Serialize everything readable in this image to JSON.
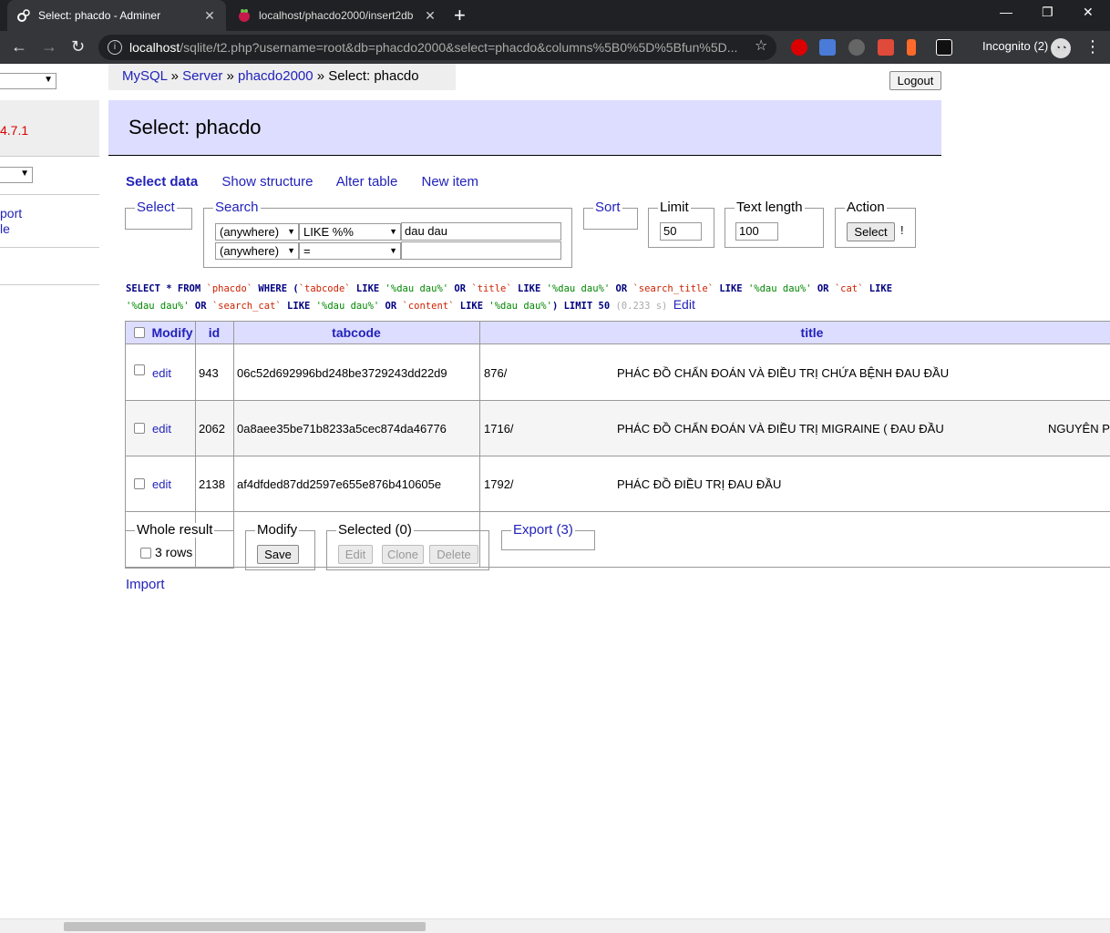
{
  "browser": {
    "tabs": [
      {
        "title": "Select: phacdo - Adminer"
      },
      {
        "title": "localhost/phacdo2000/insert2db"
      }
    ],
    "url_host": "localhost",
    "url_path": "/sqlite/t2.php?username=root&db=phacdo2000&select=phacdo&columns%5B0%5D%5Bfun%5D...",
    "incognito_label": "Incognito (2)"
  },
  "sidebar": {
    "version": "4.7.1",
    "link1": "port",
    "link2": "le"
  },
  "breadcrumb": {
    "mysql": "MySQL",
    "server": "Server",
    "db": "phacdo2000",
    "current": "Select: phacdo",
    "sep": "»"
  },
  "logout_label": "Logout",
  "page_title": "Select: phacdo",
  "links": {
    "select_data": "Select data",
    "show_structure": "Show structure",
    "alter_table": "Alter table",
    "new_item": "New item"
  },
  "form": {
    "select_legend": "Select",
    "search_legend": "Search",
    "search_rows": [
      {
        "column": "(anywhere)",
        "operator": "LIKE %%",
        "value": "dau dau"
      },
      {
        "column": "(anywhere)",
        "operator": "=",
        "value": ""
      }
    ],
    "sort_legend": "Sort",
    "limit_legend": "Limit",
    "limit_value": "50",
    "text_length_legend": "Text length",
    "text_length_value": "100",
    "action_legend": "Action",
    "select_button": "Select",
    "action_help": "!"
  },
  "sql": {
    "p1": "SELECT * FROM",
    "t1": "`phacdo`",
    "p2": "WHERE (",
    "c1": "`tabcode`",
    "p3": "LIKE",
    "s1": "'%dau dau%'",
    "p4": "OR",
    "c2": "`title`",
    "p5": "LIKE",
    "s2": "'%dau dau%'",
    "p6": "OR",
    "c3": "`search_title`",
    "p7": "LIKE",
    "s3": "'%dau dau%'",
    "p8": "OR",
    "c4": "`cat`",
    "p9": "LIKE",
    "s4": "'%dau dau%'",
    "p10": "OR",
    "c5": "`search_cat`",
    "p11": "LIKE",
    "s5": "'%dau dau%'",
    "p12": "OR",
    "c6": "`content`",
    "p13": "LIKE",
    "s6": "'%dau dau%'",
    "p14": ") LIMIT 50",
    "time": "(0.233 s)",
    "edit": "Edit"
  },
  "table": {
    "headers": {
      "modify": "Modify",
      "id": "id",
      "tabcode": "tabcode",
      "title": "title"
    },
    "rows": [
      {
        "edit": "edit",
        "id": "943",
        "tabcode": "06c52d692996bd248be3729243dd22d9",
        "tabnum": "876/",
        "title": "PHÁC ĐỒ CHẨN ĐOÁN VÀ ĐIỀU TRỊ CHỨA BỆNH ĐAU ĐẦU",
        "extra": ""
      },
      {
        "edit": "edit",
        "id": "2062",
        "tabcode": "0a8aee35be71b8233a5cec874da46776",
        "tabnum": "1716/",
        "title": "PHÁC ĐỒ CHẨN ĐOÁN VÀ ĐIỀU TRỊ MIGRAINE ( ĐAU ĐẦU",
        "extra": "NGUYÊN P"
      },
      {
        "edit": "edit",
        "id": "2138",
        "tabcode": "af4dfded87dd2597e655e876b410605e",
        "tabnum": "1792/",
        "title": "PHÁC ĐỒ ĐIỀU TRỊ ĐAU ĐẦU",
        "extra": ""
      }
    ]
  },
  "bottom": {
    "whole_result_legend": "Whole result",
    "rows_label": "3 rows",
    "modify_legend": "Modify",
    "save_button": "Save",
    "selected_legend": "Selected (0)",
    "edit_button": "Edit",
    "clone_button": "Clone",
    "delete_button": "Delete",
    "export_legend": "Export (3)",
    "import_link": "Import"
  }
}
